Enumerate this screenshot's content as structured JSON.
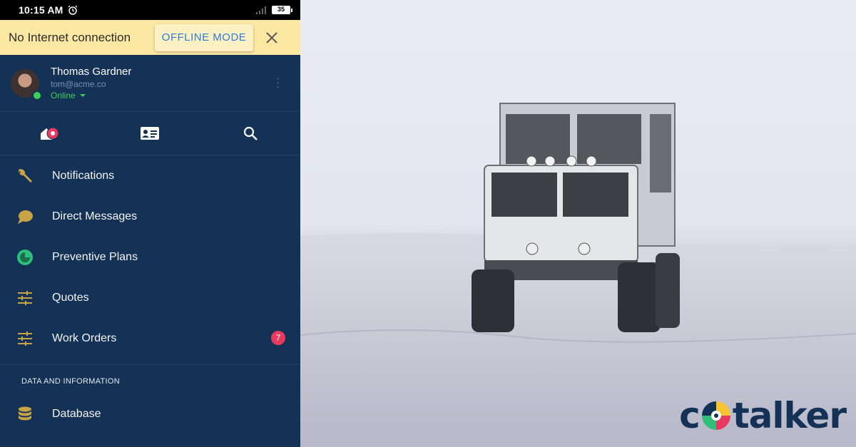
{
  "statusbar": {
    "time": "10:15 AM",
    "battery": "35"
  },
  "offline_banner": {
    "message": "No Internet connection",
    "button_label": "OFFLINE MODE"
  },
  "profile": {
    "name": "Thomas Gardner",
    "email": "tom@acme.co",
    "status": "Online"
  },
  "menu": {
    "items": [
      {
        "label": "Notifications",
        "icon": "wrench-icon"
      },
      {
        "label": "Direct Messages",
        "icon": "chat-bubble-icon"
      },
      {
        "label": "Preventive Plans",
        "icon": "clock-icon"
      },
      {
        "label": "Quotes",
        "icon": "sliders-icon"
      },
      {
        "label": "Work Orders",
        "icon": "sliders-icon",
        "badge": "7"
      }
    ],
    "section_title": "DATA AND INFORMATION",
    "section_items": [
      {
        "label": "Database",
        "icon": "database-icon"
      }
    ]
  },
  "logo": {
    "text_prefix": "c",
    "text_suffix": "talker"
  },
  "colors": {
    "panel": "#143156",
    "banner": "#fbe8a2",
    "accent_blue": "#2f7bd6",
    "badge": "#e83a5e",
    "online": "#3ccf5a",
    "icon_gold": "#c9a447"
  }
}
